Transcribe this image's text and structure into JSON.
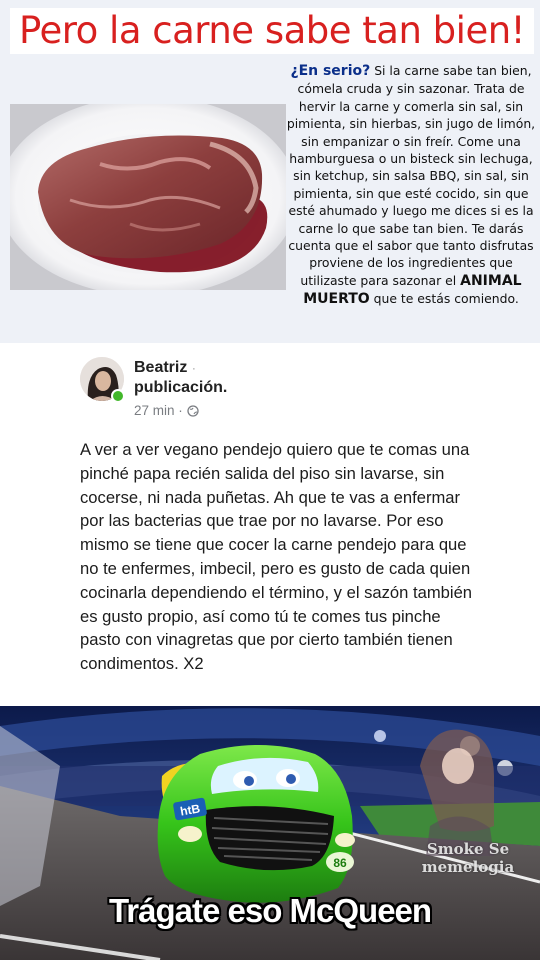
{
  "poster": {
    "title": "Pero la carne sabe tan bien!",
    "lead": "¿En serio?",
    "body": " Si la carne sabe tan bien, cómela cruda y sin sazonar. Trata de hervir la carne y comerla sin sal, sin pimienta, sin hierbas, sin jugo de limón, sin empanizar o sin freír. Come una hamburguesa o un bisteck sin lechuga, sin ketchup, sin salsa BBQ, sin sal, sin pimienta, sin que esté cocido, sin que esté ahumado y luego me dices si es la carne lo que sabe tan bien. Te darás cuenta que el sabor que tanto disfrutas proviene de los ingredientes que utilizaste para sazonar el ",
    "emphasis": "ANIMAL MUERTO",
    "tail": " que te estás comiendo.",
    "title_color": "#d8201f",
    "photo_icon": "raw-steak-on-plate"
  },
  "post": {
    "author": "Beatriz",
    "author_suffix": "·",
    "action": "publicación.",
    "time": "27 min ·",
    "privacy_icon": "globe-icon",
    "text": "A ver a ver vegano pendejo quiero que te comas una pinché papa recién salida del piso sin lavarse, sin cocerse, ni nada puñetas. Ah que te vas a enfermar por las bacterias que trae por no lavarse. Por eso mismo se tiene que cocer la carne pendejo para que no te enfermes, imbecil, pero es gusto de cada quien cocinarla dependiendo el término, y el sazón también es gusto propio, así como tú te comes tus pinche pasto con vinagretas que por cierto también tienen condimentos. X2"
  },
  "meme": {
    "caption": "Trágate eso McQueen",
    "watermark_line1": "Smoke Se",
    "watermark_line2": "memelogia",
    "car_number": "86",
    "car_sticker": "htB",
    "car_color": "#3cc81c"
  }
}
